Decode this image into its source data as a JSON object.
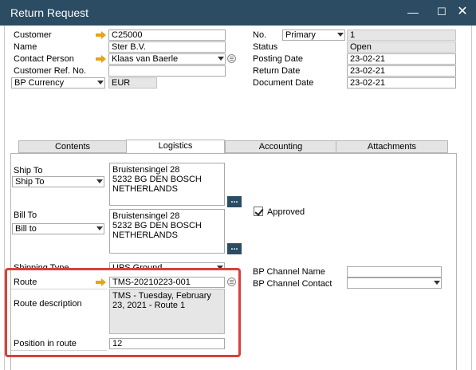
{
  "window": {
    "title": "Return Request",
    "controls": [
      "minimize-icon",
      "maximize-icon",
      "close-icon"
    ]
  },
  "header_left": {
    "customer_label": "Customer",
    "customer_value": "C25000",
    "name_label": "Name",
    "name_value": "Ster B.V.",
    "contact_label": "Contact Person",
    "contact_value": "Klaas van Baerle",
    "ref_label": "Customer Ref. No.",
    "ref_value": "",
    "currency_combo": "BP Currency",
    "currency_value": "EUR"
  },
  "header_right": {
    "no_label": "No.",
    "series_value": "Primary",
    "no_value": "1",
    "status_label": "Status",
    "status_value": "Open",
    "posting_label": "Posting Date",
    "posting_value": "23-02-21",
    "return_label": "Return Date",
    "return_value": "23-02-21",
    "document_label": "Document Date",
    "document_value": "23-02-21"
  },
  "tabs": [
    {
      "label": "Contents",
      "active": false
    },
    {
      "label": "Logistics",
      "active": true
    },
    {
      "label": "Accounting",
      "active": false
    },
    {
      "label": "Attachments",
      "active": false
    }
  ],
  "logistics": {
    "ship_to_label": "Ship To",
    "ship_to_combo": "Ship To",
    "ship_to_address": "Bruistensingel 28\n5232 BG  DEN BOSCH\nNETHERLANDS",
    "bill_to_label": "Bill To",
    "bill_to_combo": "Bill to",
    "bill_to_address": "Bruistensingel 28\n5232 BG  DEN BOSCH\nNETHERLANDS",
    "dots_label": "...",
    "approved_label": "Approved",
    "approved_checked": true,
    "shipping_type_label": "Shipping Type",
    "shipping_type_value": "UPS Ground",
    "route_label": "Route",
    "route_value": "TMS-20210223-001",
    "route_desc_label": "Route description",
    "route_desc_value": "TMS - Tuesday, February 23, 2021 - Route 1",
    "position_label": "Position in route",
    "position_value": "12",
    "bp_channel_name_label": "BP Channel Name",
    "bp_channel_name_value": "",
    "bp_channel_contact_label": "BP Channel Contact",
    "bp_channel_contact_value": ""
  },
  "colors": {
    "titlebar": "#2b4c63",
    "highlight": "#d9403a",
    "link_arrow": "#e8a31a"
  }
}
